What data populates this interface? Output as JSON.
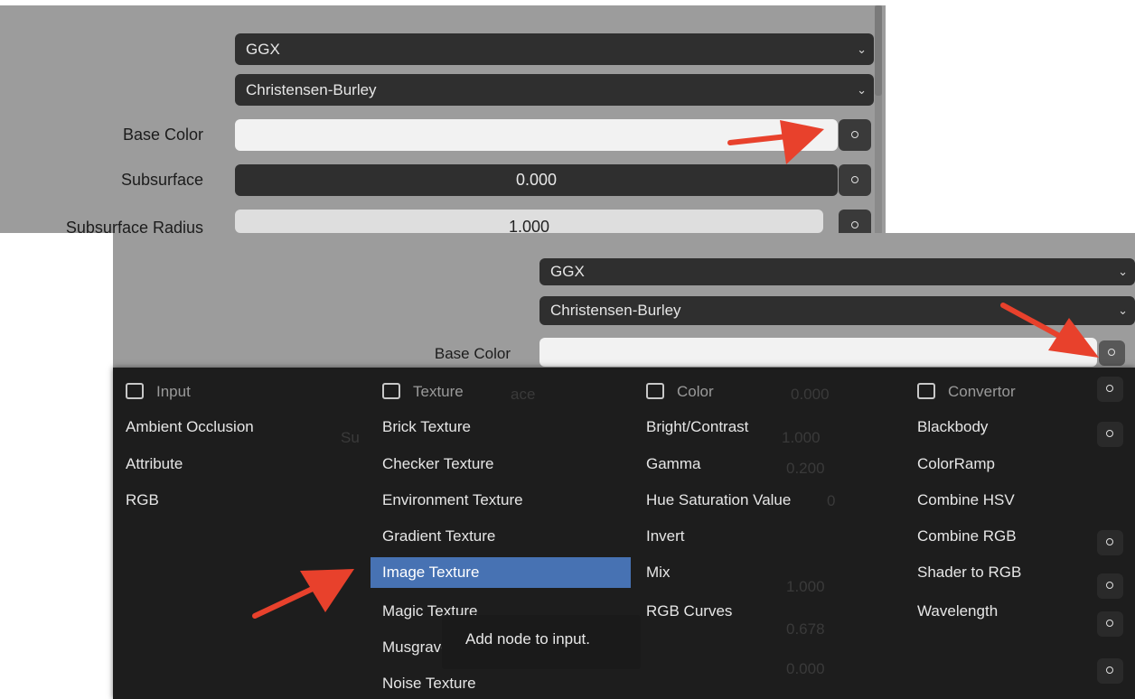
{
  "top_panel": {
    "distribution": "GGX",
    "subsurface_method": "Christensen-Burley",
    "base_color_label": "Base Color",
    "subsurface_label": "Subsurface",
    "subsurface_value": "0.000",
    "subsurface_radius_label": "Subsurface Radius",
    "subsurface_radius_value": "1.000"
  },
  "bottom_panel": {
    "distribution": "GGX",
    "subsurface_method": "Christensen-Burley",
    "base_color_label": "Base Color",
    "behind_menu": [
      "ace",
      "0.000",
      "Su",
      "1.000",
      "0.200",
      "0",
      "1.000",
      "0.678",
      "0.000"
    ]
  },
  "menu": {
    "columns": [
      {
        "header": "Input",
        "items": [
          "Ambient Occlusion",
          "Attribute",
          "RGB"
        ]
      },
      {
        "header": "Texture",
        "items": [
          "Brick Texture",
          "Checker Texture",
          "Environment Texture",
          "Gradient Texture",
          "Image Texture",
          "Magic Texture",
          "Musgrave Texture",
          "Noise Texture"
        ]
      },
      {
        "header": "Color",
        "items": [
          "Bright/Contrast",
          "Gamma",
          "Hue Saturation Value",
          "Invert",
          "Mix",
          "RGB Curves"
        ]
      },
      {
        "header": "Convertor",
        "items": [
          "Blackbody",
          "ColorRamp",
          "Combine HSV",
          "Combine RGB",
          "Shader to RGB",
          "Wavelength"
        ]
      }
    ],
    "selected": "Image Texture"
  },
  "tooltip": "Add node to input.",
  "colors": {
    "highlight": "#4772b3",
    "annotation_arrow": "#e8412c",
    "menu_bg": "#1d1d1d"
  }
}
